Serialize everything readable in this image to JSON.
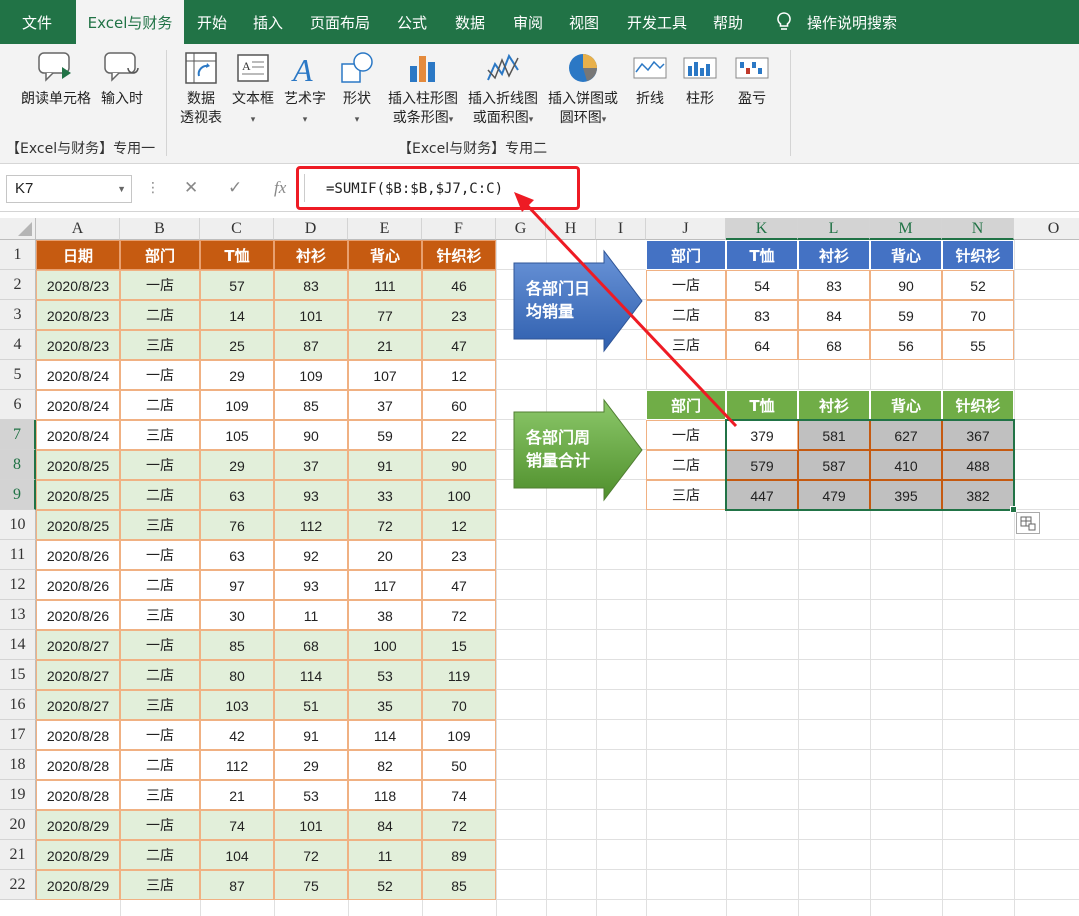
{
  "tabs": [
    "文件",
    "Excel与财务",
    "开始",
    "插入",
    "页面布局",
    "公式",
    "数据",
    "审阅",
    "视图",
    "开发工具",
    "帮助"
  ],
  "tell_me": "操作说明搜索",
  "ribbon": {
    "group1": {
      "read_cell": "朗读单元格",
      "input_time": "输入时",
      "label": "【Excel与财务】专用一"
    },
    "group2": {
      "pivot_l1": "数据",
      "pivot_l2": "透视表",
      "textbox": "文本框",
      "wordart": "艺术字",
      "shapes": "形状",
      "bar_l1": "插入柱形图",
      "bar_l2": "或条形图",
      "line_l1": "插入折线图",
      "line_l2": "或面积图",
      "pie_l1": "插入饼图或",
      "pie_l2": "圆环图",
      "spark_line": "折线",
      "spark_col": "柱形",
      "spark_wl": "盈亏",
      "label": "【Excel与财务】专用二"
    }
  },
  "namebox": "K7",
  "formula": "=SUMIF($B:$B,$J7,C:C)",
  "columns": [
    "A",
    "B",
    "C",
    "D",
    "E",
    "F",
    "G",
    "H",
    "I",
    "J",
    "K",
    "L",
    "M",
    "N",
    "O"
  ],
  "rows": [
    "1",
    "2",
    "3",
    "4",
    "5",
    "6",
    "7",
    "8",
    "9",
    "10",
    "11",
    "12",
    "13",
    "14",
    "15",
    "16",
    "17",
    "18",
    "19",
    "20",
    "21",
    "22"
  ],
  "left_table": {
    "headers": [
      "日期",
      "部门",
      "T恤",
      "衬衫",
      "背心",
      "针织衫"
    ],
    "rows": [
      [
        "2020/8/23",
        "一店",
        "57",
        "83",
        "111",
        "46"
      ],
      [
        "2020/8/23",
        "二店",
        "14",
        "101",
        "77",
        "23"
      ],
      [
        "2020/8/23",
        "三店",
        "25",
        "87",
        "21",
        "47"
      ],
      [
        "2020/8/24",
        "一店",
        "29",
        "109",
        "107",
        "12"
      ],
      [
        "2020/8/24",
        "二店",
        "109",
        "85",
        "37",
        "60"
      ],
      [
        "2020/8/24",
        "三店",
        "105",
        "90",
        "59",
        "22"
      ],
      [
        "2020/8/25",
        "一店",
        "29",
        "37",
        "91",
        "90"
      ],
      [
        "2020/8/25",
        "二店",
        "63",
        "93",
        "33",
        "100"
      ],
      [
        "2020/8/25",
        "三店",
        "76",
        "112",
        "72",
        "12"
      ],
      [
        "2020/8/26",
        "一店",
        "63",
        "92",
        "20",
        "23"
      ],
      [
        "2020/8/26",
        "二店",
        "97",
        "93",
        "117",
        "47"
      ],
      [
        "2020/8/26",
        "三店",
        "30",
        "11",
        "38",
        "72"
      ],
      [
        "2020/8/27",
        "一店",
        "85",
        "68",
        "100",
        "15"
      ],
      [
        "2020/8/27",
        "二店",
        "80",
        "114",
        "53",
        "119"
      ],
      [
        "2020/8/27",
        "三店",
        "103",
        "51",
        "35",
        "70"
      ],
      [
        "2020/8/28",
        "一店",
        "42",
        "91",
        "114",
        "109"
      ],
      [
        "2020/8/28",
        "二店",
        "112",
        "29",
        "82",
        "50"
      ],
      [
        "2020/8/28",
        "三店",
        "21",
        "53",
        "118",
        "74"
      ],
      [
        "2020/8/29",
        "一店",
        "74",
        "101",
        "84",
        "72"
      ],
      [
        "2020/8/29",
        "二店",
        "104",
        "72",
        "11",
        "89"
      ],
      [
        "2020/8/29",
        "三店",
        "87",
        "75",
        "52",
        "85"
      ]
    ]
  },
  "daily_avg_table": {
    "headers": [
      "部门",
      "T恤",
      "衬衫",
      "背心",
      "针织衫"
    ],
    "rows": [
      [
        "一店",
        "54",
        "83",
        "90",
        "52"
      ],
      [
        "二店",
        "83",
        "84",
        "59",
        "70"
      ],
      [
        "三店",
        "64",
        "68",
        "56",
        "55"
      ]
    ]
  },
  "weekly_sum_table": {
    "headers": [
      "部门",
      "T恤",
      "衬衫",
      "背心",
      "针织衫"
    ],
    "rows": [
      [
        "一店",
        "379",
        "581",
        "627",
        "367"
      ],
      [
        "二店",
        "579",
        "587",
        "410",
        "488"
      ],
      [
        "三店",
        "447",
        "479",
        "395",
        "382"
      ]
    ]
  },
  "callouts": {
    "daily": [
      "各部门日",
      "均销量"
    ],
    "weekly": [
      "各部门周",
      "销量合计"
    ]
  },
  "colors": {
    "excel_green": "#217346",
    "orange_header": "#c65b11",
    "blue_header": "#4472c4",
    "green_header": "#70ad47",
    "light_green_fill": "#e2efda",
    "selected_fill": "#c0c0c0",
    "arrow_red": "#ee1b24"
  }
}
